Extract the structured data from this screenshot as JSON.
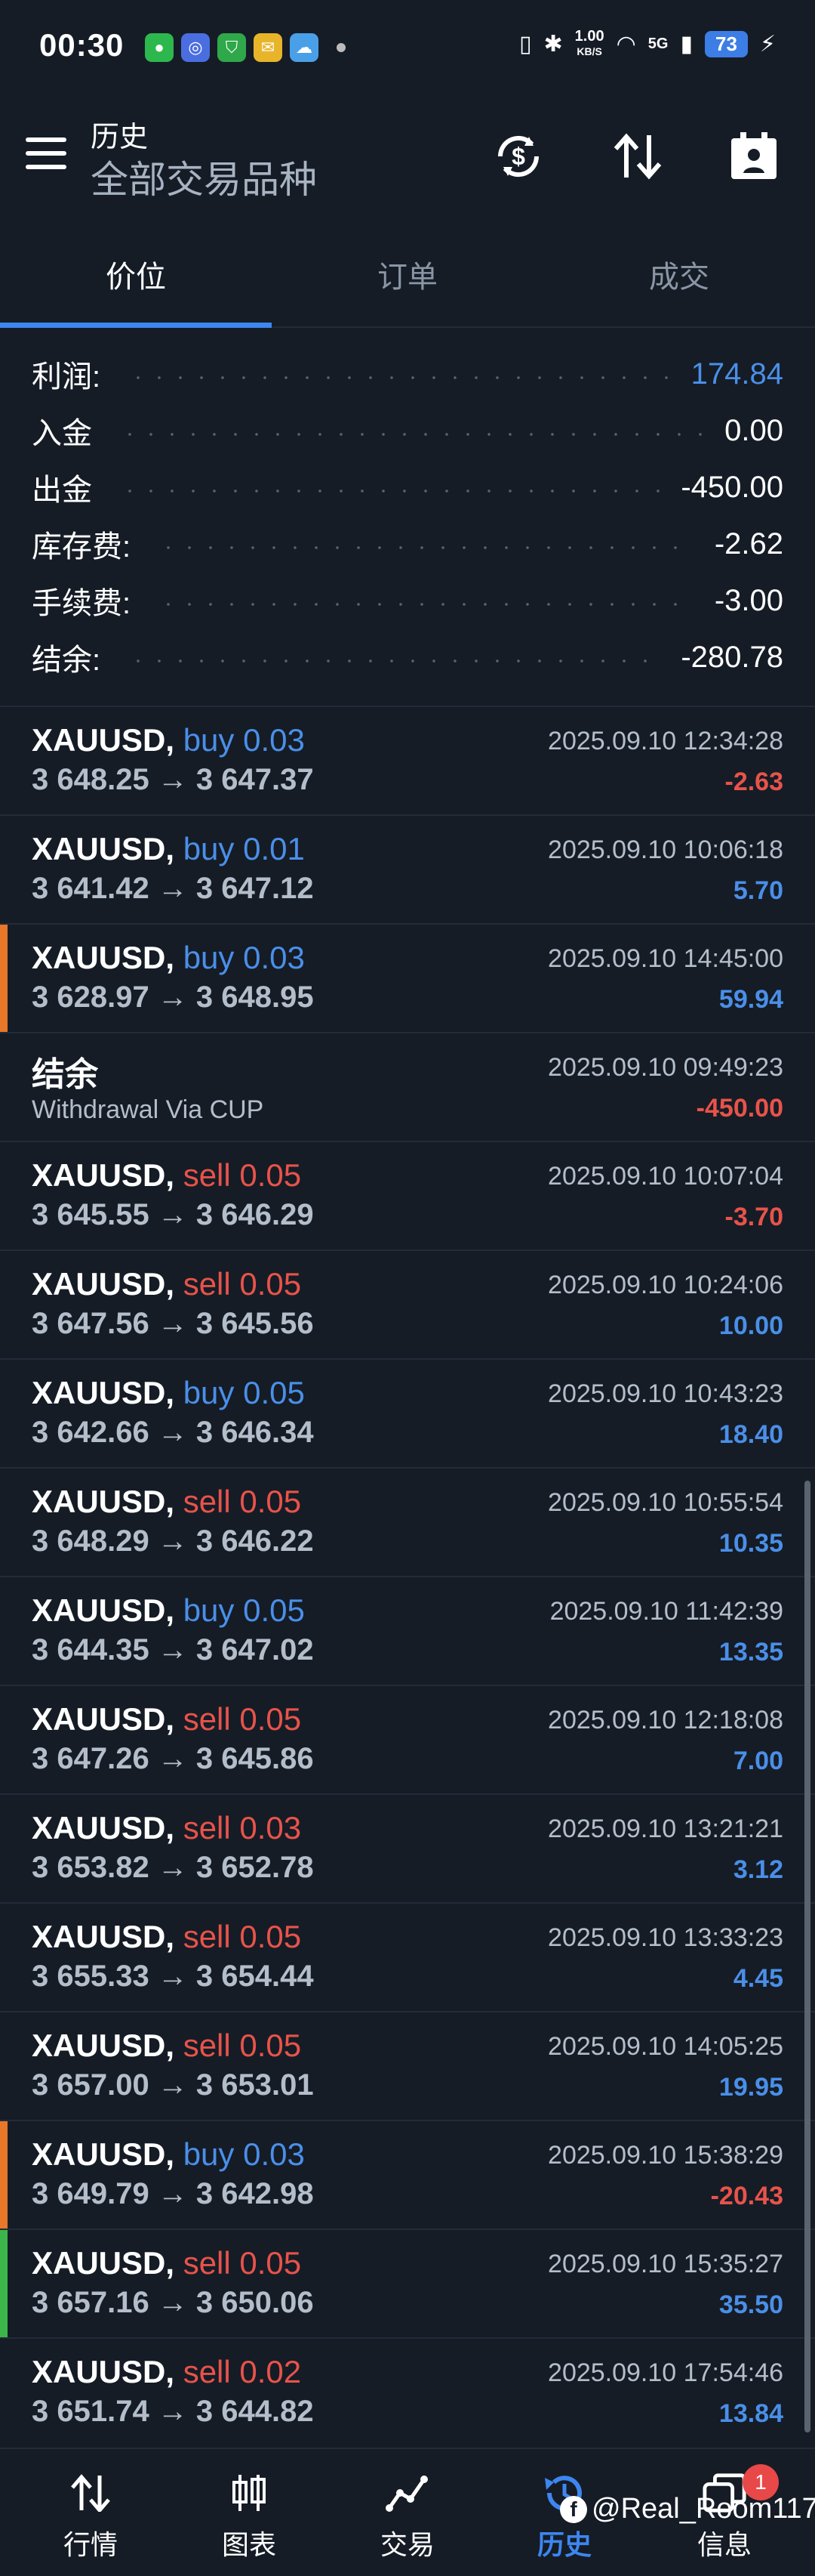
{
  "status_bar": {
    "time": "00:30",
    "speed_top": "1.00",
    "speed_bottom": "KB/S",
    "network": "5G",
    "battery": "73"
  },
  "header": {
    "title": "历史",
    "subtitle": "全部交易品种"
  },
  "tabs": [
    "价位",
    "订单",
    "成交"
  ],
  "summary": [
    {
      "label": "利润:",
      "value": "174.84",
      "accent": true
    },
    {
      "label": "入金",
      "value": "0.00"
    },
    {
      "label": "出金",
      "value": "-450.00"
    },
    {
      "label": "库存费:",
      "value": "-2.62"
    },
    {
      "label": "手续费:",
      "value": "-3.00"
    },
    {
      "label": "结余:",
      "value": "-280.78"
    }
  ],
  "rows": [
    {
      "symbol": "XAUUSD,",
      "side": "buy",
      "volume": "buy 0.03",
      "prices": "3 648.25 → 3 647.37",
      "time": "2025.09.10 12:34:28",
      "profit": "-2.63",
      "marker": ""
    },
    {
      "symbol": "XAUUSD,",
      "side": "buy",
      "volume": "buy 0.01",
      "prices": "3 641.42 → 3 647.12",
      "time": "2025.09.10 10:06:18",
      "profit": "5.70",
      "marker": ""
    },
    {
      "symbol": "XAUUSD,",
      "side": "buy",
      "volume": "buy 0.03",
      "prices": "3 628.97 → 3 648.95",
      "time": "2025.09.10 14:45:00",
      "profit": "59.94",
      "marker": "#e8772a"
    },
    {
      "type": "balance",
      "title": "结余",
      "comment": "Withdrawal Via CUP",
      "time": "2025.09.10 09:49:23",
      "profit": "-450.00"
    },
    {
      "symbol": "XAUUSD,",
      "side": "sell",
      "volume": "sell 0.05",
      "prices": "3 645.55 → 3 646.29",
      "time": "2025.09.10 10:07:04",
      "profit": "-3.70",
      "marker": ""
    },
    {
      "symbol": "XAUUSD,",
      "side": "sell",
      "volume": "sell 0.05",
      "prices": "3 647.56 → 3 645.56",
      "time": "2025.09.10 10:24:06",
      "profit": "10.00",
      "marker": ""
    },
    {
      "symbol": "XAUUSD,",
      "side": "buy",
      "volume": "buy 0.05",
      "prices": "3 642.66 → 3 646.34",
      "time": "2025.09.10 10:43:23",
      "profit": "18.40",
      "marker": ""
    },
    {
      "symbol": "XAUUSD,",
      "side": "sell",
      "volume": "sell 0.05",
      "prices": "3 648.29 → 3 646.22",
      "time": "2025.09.10 10:55:54",
      "profit": "10.35",
      "marker": ""
    },
    {
      "symbol": "XAUUSD,",
      "side": "buy",
      "volume": "buy 0.05",
      "prices": "3 644.35 → 3 647.02",
      "time": "2025.09.10 11:42:39",
      "profit": "13.35",
      "marker": ""
    },
    {
      "symbol": "XAUUSD,",
      "side": "sell",
      "volume": "sell 0.05",
      "prices": "3 647.26 → 3 645.86",
      "time": "2025.09.10 12:18:08",
      "profit": "7.00",
      "marker": ""
    },
    {
      "symbol": "XAUUSD,",
      "side": "sell",
      "volume": "sell 0.03",
      "prices": "3 653.82 → 3 652.78",
      "time": "2025.09.10 13:21:21",
      "profit": "3.12",
      "marker": ""
    },
    {
      "symbol": "XAUUSD,",
      "side": "sell",
      "volume": "sell 0.05",
      "prices": "3 655.33 → 3 654.44",
      "time": "2025.09.10 13:33:23",
      "profit": "4.45",
      "marker": ""
    },
    {
      "symbol": "XAUUSD,",
      "side": "sell",
      "volume": "sell 0.05",
      "prices": "3 657.00 → 3 653.01",
      "time": "2025.09.10 14:05:25",
      "profit": "19.95",
      "marker": ""
    },
    {
      "symbol": "XAUUSD,",
      "side": "buy",
      "volume": "buy 0.03",
      "prices": "3 649.79 → 3 642.98",
      "time": "2025.09.10 15:38:29",
      "profit": "-20.43",
      "marker": "#e8772a"
    },
    {
      "symbol": "XAUUSD,",
      "side": "sell",
      "volume": "sell 0.05",
      "prices": "3 657.16 → 3 650.06",
      "time": "2025.09.10 15:35:27",
      "profit": "35.50",
      "marker": "#3cb54a"
    },
    {
      "symbol": "XAUUSD,",
      "side": "sell",
      "volume": "sell 0.02",
      "prices": "3 651.74 → 3 644.82",
      "time": "2025.09.10 17:54:46",
      "profit": "13.84",
      "marker": ""
    }
  ],
  "bottom_nav": [
    {
      "label": "行情",
      "icon": "quotes-icon"
    },
    {
      "label": "图表",
      "icon": "chart-icon"
    },
    {
      "label": "交易",
      "icon": "trade-icon"
    },
    {
      "label": "历史",
      "icon": "history-icon",
      "active": true
    },
    {
      "label": "信息",
      "icon": "messages-icon",
      "badge": "1"
    }
  ],
  "watermark": "@Real_Room117",
  "colors": {
    "accent": "#3d86f0",
    "buy": "#4a8fe8",
    "sell": "#e8534a",
    "background": "#151c26"
  }
}
